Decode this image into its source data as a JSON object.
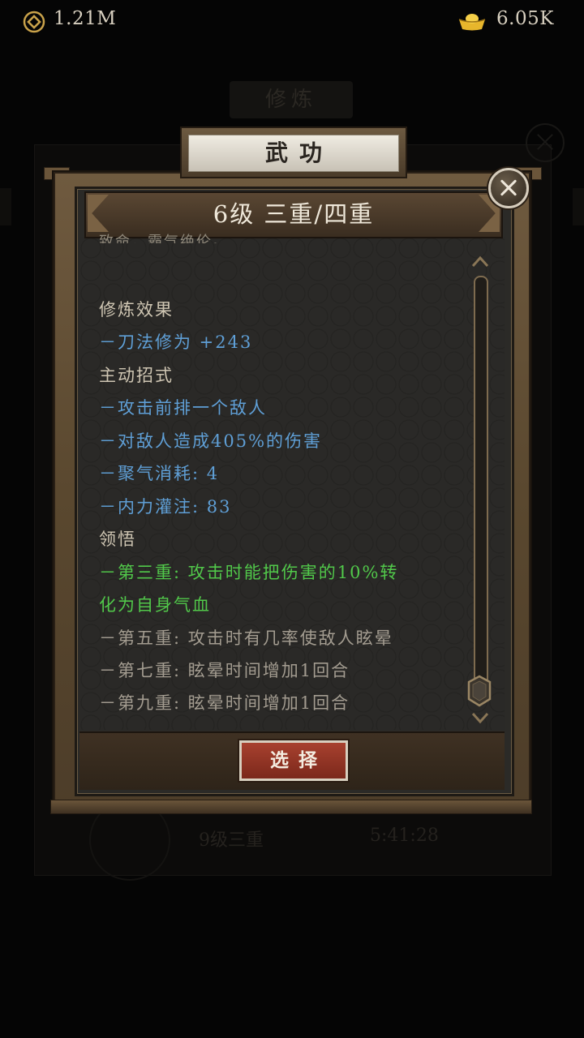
{
  "currency": {
    "coins": "1.21M",
    "gold": "6.05K"
  },
  "background": {
    "title": "修炼",
    "row_text_1": "9级三重",
    "row_text_2": "5:41:28"
  },
  "dialog": {
    "tab_title": "武功",
    "level_banner": "6级 三重/四重",
    "clipped_text": "致命，霸气绝伦。",
    "lines": [
      {
        "text": "修炼效果",
        "style": "head"
      },
      {
        "text": "－刀法修为 +243",
        "style": "blue"
      },
      {
        "text": "主动招式",
        "style": "head"
      },
      {
        "text": "－攻击前排一个敌人",
        "style": "blue"
      },
      {
        "text": "－对敌人造成405%的伤害",
        "style": "blue"
      },
      {
        "text": "－聚气消耗: 4",
        "style": "blue"
      },
      {
        "text": "－内力灌注: 83",
        "style": "blue"
      },
      {
        "text": "领悟",
        "style": "head"
      },
      {
        "text": "－第三重: 攻击时能把伤害的10%转",
        "style": "green"
      },
      {
        "text": "化为自身气血",
        "style": "green"
      },
      {
        "text": "－第五重: 攻击时有几率使敌人眩晕",
        "style": "gray"
      },
      {
        "text": "－第七重: 眩晕时间增加1回合",
        "style": "gray"
      },
      {
        "text": "－第九重: 眩晕时间增加1回合",
        "style": "gray"
      }
    ],
    "select_label": "选择"
  },
  "colors": {
    "effect_blue": "#5f9fd6",
    "unlocked_green": "#51c84a",
    "locked_gray": "#a39c90",
    "button_red": "#a8412f"
  }
}
